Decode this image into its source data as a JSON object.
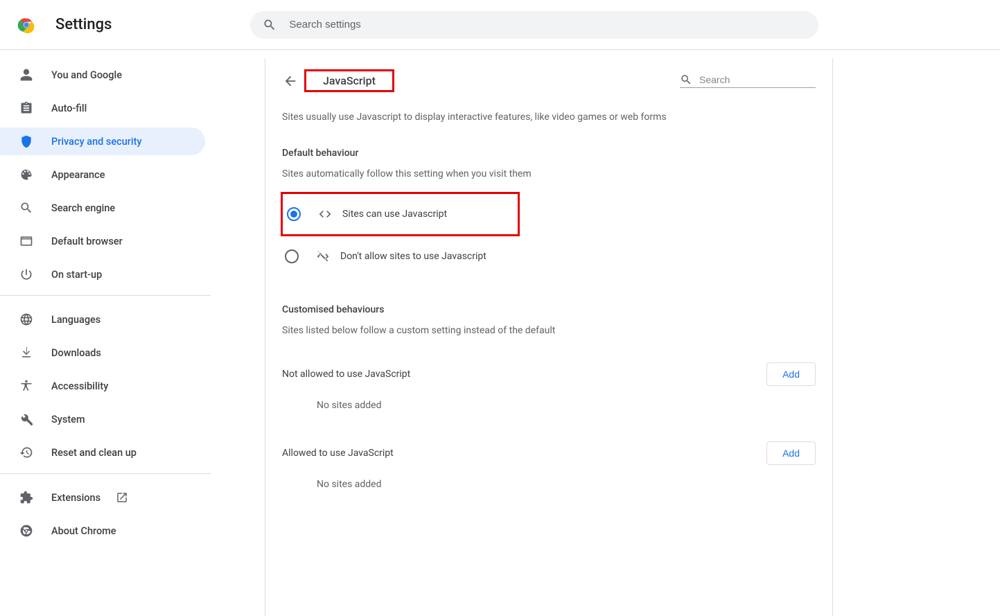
{
  "header": {
    "title": "Settings",
    "search_placeholder": "Search settings"
  },
  "sidebar": {
    "items": [
      {
        "id": "you-and-google",
        "label": "You and Google",
        "icon": "person"
      },
      {
        "id": "autofill",
        "label": "Auto-fill",
        "icon": "clipboard"
      },
      {
        "id": "privacy",
        "label": "Privacy and security",
        "icon": "shield",
        "selected": true
      },
      {
        "id": "appearance",
        "label": "Appearance",
        "icon": "palette"
      },
      {
        "id": "search-engine",
        "label": "Search engine",
        "icon": "search"
      },
      {
        "id": "default-browser",
        "label": "Default browser",
        "icon": "browser"
      },
      {
        "id": "on-startup",
        "label": "On start-up",
        "icon": "power"
      }
    ],
    "advanced": [
      {
        "id": "languages",
        "label": "Languages",
        "icon": "globe"
      },
      {
        "id": "downloads",
        "label": "Downloads",
        "icon": "download"
      },
      {
        "id": "accessibility",
        "label": "Accessibility",
        "icon": "accessibility"
      },
      {
        "id": "system",
        "label": "System",
        "icon": "wrench"
      },
      {
        "id": "reset",
        "label": "Reset and clean up",
        "icon": "restore"
      }
    ],
    "footer": [
      {
        "id": "extensions",
        "label": "Extensions",
        "icon": "puzzle",
        "external": true
      },
      {
        "id": "about",
        "label": "About Chrome",
        "icon": "chrome"
      }
    ]
  },
  "panel": {
    "title": "JavaScript",
    "search_placeholder": "Search",
    "intro": "Sites usually use Javascript to display interactive features, like video games or web forms",
    "default_title": "Default behaviour",
    "default_sub": "Sites automatically follow this setting when you visit them",
    "radio_allow": "Sites can use Javascript",
    "radio_block": "Don't allow sites to use Javascript",
    "custom_title": "Customised behaviours",
    "custom_sub": "Sites listed below follow a custom setting instead of the default",
    "list_block_title": "Not allowed to use JavaScript",
    "list_allow_title": "Allowed to use JavaScript",
    "empty": "No sites added",
    "add_label": "Add"
  }
}
